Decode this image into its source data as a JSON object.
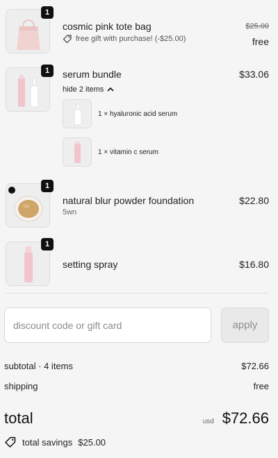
{
  "items": [
    {
      "quantity": "1",
      "title": "cosmic pink tote bag",
      "original_price": "$25.00",
      "price": "free",
      "gift_note": "free gift with purchase! (-$25.00)",
      "icon": "tag-icon"
    },
    {
      "quantity": "1",
      "title": "serum bundle",
      "price": "$33.06",
      "toggle_label": "hide 2 items",
      "toggle_icon": "chevron-up-icon",
      "bundle_items": [
        {
          "label": "1 × hyaluronic acid serum"
        },
        {
          "label": "1 × vitamin c serum"
        }
      ]
    },
    {
      "quantity": "1",
      "title": "natural blur powder foundation",
      "variant": "5wn",
      "price": "$22.80"
    },
    {
      "quantity": "1",
      "title": "setting spray",
      "price": "$16.80"
    }
  ],
  "discount": {
    "placeholder": "discount code or gift card",
    "apply_label": "apply"
  },
  "summary": {
    "subtotal_label": "subtotal · 4 items",
    "subtotal_value": "$72.66",
    "shipping_label": "shipping",
    "shipping_value": "free",
    "total_label": "total",
    "currency": "usd",
    "total_value": "$72.66",
    "savings_label": "total savings",
    "savings_value": "$25.00",
    "savings_icon": "tag-icon"
  },
  "colors": {
    "background": "#f5f5f5",
    "badge": "#111111",
    "product_pink": "#f2c4cc"
  }
}
